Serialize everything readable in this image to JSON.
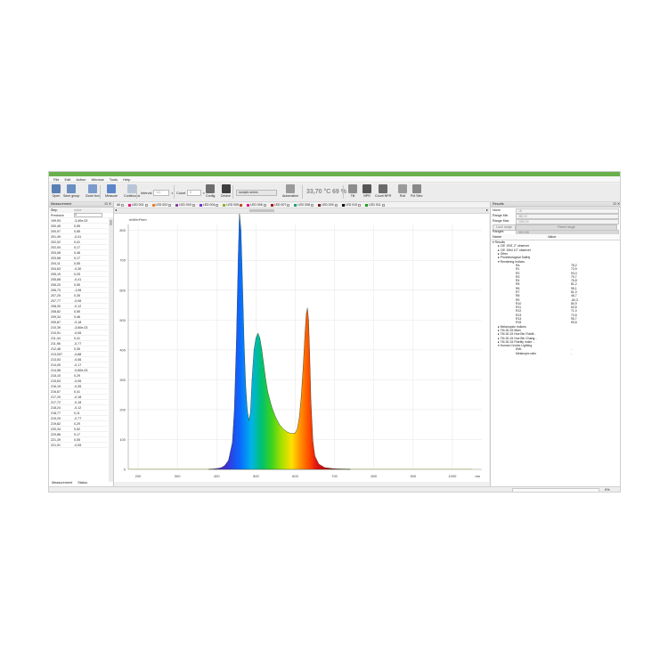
{
  "menu": [
    "File",
    "Edit",
    "Action",
    "Window",
    "Tools",
    "Help"
  ],
  "toolbar": {
    "buttons": [
      {
        "label": "Open",
        "icon": "folder-icon",
        "color": "#5a7fb5"
      },
      {
        "label": "Save group",
        "icon": "save-icon",
        "color": "#6a8fc0"
      },
      {
        "label": "Zoom box",
        "icon": "magnifier-icon",
        "color": "#7a9ccc"
      },
      {
        "label": "Measure",
        "icon": "spectrum-icon",
        "color": "#5b86c9"
      },
      {
        "label": "Continuous",
        "icon": "continuous-icon",
        "color": "#b8c6d8"
      },
      {
        "label": "Config",
        "icon": "tools-icon",
        "color": "#6d6d6d"
      },
      {
        "label": "Device",
        "icon": "device-icon",
        "color": "#3e3e3e"
      },
      {
        "label": "Automation",
        "icon": "gear-icon",
        "color": "#9a9a9a"
      },
      {
        "label": "Tilt",
        "icon": "tilt-icon",
        "color": "#8d8d8d"
      },
      {
        "label": "NPR",
        "icon": "npr-icon",
        "color": "#555555"
      },
      {
        "label": "Count NPR",
        "icon": "count-npr-icon",
        "color": "#6a6a6a"
      },
      {
        "label": "Roll",
        "icon": "roll-icon",
        "color": "#9a9a9a"
      },
      {
        "label": "Pol Stev",
        "icon": "pol-icon",
        "color": "#888888"
      }
    ],
    "interval_label": "Interval",
    "interval_value": "0,0",
    "count_label": "Count",
    "count_value": "0",
    "sample_value": "sample-series",
    "temperature": "33,70 °C",
    "percent": "69 %"
  },
  "left_panel": {
    "title": "Measurement",
    "step_label": "Step",
    "step_value": "value",
    "precision_label": "Precision",
    "precision_value": "1",
    "rows": [
      [
        "199,93",
        "-3,40e-03"
      ],
      [
        "200,45",
        "0,55"
      ],
      [
        "200,97",
        "0,55"
      ],
      [
        "201,49",
        "-0,41"
      ],
      [
        "202,02",
        "0,41"
      ],
      [
        "202,54",
        "0,17"
      ],
      [
        "203,06",
        "0,46"
      ],
      [
        "203,58",
        "0,17"
      ],
      [
        "204,11",
        "0,55"
      ],
      [
        "204,63",
        "-0,30"
      ],
      [
        "205,15",
        "0,25"
      ],
      [
        "205,68",
        "-0,41"
      ],
      [
        "206,20",
        "0,55"
      ],
      [
        "206,73",
        "-1,06"
      ],
      [
        "207,25",
        "0,35"
      ],
      [
        "207,77",
        "-0,06"
      ],
      [
        "208,30",
        "-0,12"
      ],
      [
        "208,82",
        "0,55"
      ],
      [
        "209,34",
        "0,46"
      ],
      [
        "209,87",
        "-0,18"
      ],
      [
        "210,39",
        "-3,60e-03"
      ],
      [
        "210,91",
        "-0,06"
      ],
      [
        "211,44",
        "0,41"
      ],
      [
        "211,96",
        "-0,77"
      ],
      [
        "212,48",
        "0,35"
      ],
      [
        "213,007",
        "-0,88"
      ],
      [
        "213,53",
        "-0,06"
      ],
      [
        "214,05",
        "-0,17"
      ],
      [
        "214,58",
        "-0,60e-03"
      ],
      [
        "215,10",
        "0,29"
      ],
      [
        "215,63",
        "-0,06"
      ],
      [
        "216,15",
        "-0,35"
      ],
      [
        "216,67",
        "0,41"
      ],
      [
        "217,20",
        "-0,18"
      ],
      [
        "217,72",
        "-0,18"
      ],
      [
        "218,24",
        "-0,12"
      ],
      [
        "218,77",
        "0,11"
      ],
      [
        "219,29",
        "-0,77"
      ],
      [
        "219,82",
        "0,29"
      ],
      [
        "220,34",
        "0,52"
      ],
      [
        "220,86",
        "0,17"
      ],
      [
        "221,39",
        "0,05"
      ],
      [
        "221,91",
        "-0,05"
      ]
    ],
    "tabs": [
      "Measurement",
      "Status"
    ]
  },
  "series_bar": {
    "all_label": "All",
    "items": [
      {
        "label": "LED 001",
        "color": "#e8177c"
      },
      {
        "label": "LED 002",
        "color": "#f07d20"
      },
      {
        "label": "LED 003",
        "color": "#8b3fa8"
      },
      {
        "label": "LED 004",
        "color": "#7a2fd0"
      },
      {
        "label": "LED 005",
        "color": "#8cb320",
        "checked": true
      },
      {
        "label": "LED 006",
        "color": "#e8177c"
      },
      {
        "label": "LED 007",
        "color": "#b01818"
      },
      {
        "label": "LED 008",
        "color": "#1aa37a"
      },
      {
        "label": "LED 009",
        "color": "#7a2020"
      },
      {
        "label": "LED 010",
        "color": "#101010"
      },
      {
        "label": "LED 011",
        "color": "#20a020"
      }
    ]
  },
  "chart_data": {
    "type": "area",
    "ylabel": "mW/m²/nm",
    "xlabel": "nm",
    "xlim": [
      175,
      1075
    ],
    "ylim": [
      0,
      820
    ],
    "xticks": [
      200,
      300,
      400,
      500,
      600,
      700,
      800,
      900,
      1000
    ],
    "yticks": [
      0,
      100,
      200,
      300,
      400,
      500,
      600,
      700,
      800
    ],
    "x": [
      380,
      395,
      410,
      420,
      430,
      440,
      445,
      450,
      455,
      458,
      462,
      466,
      470,
      474,
      478,
      482,
      486,
      490,
      495,
      500,
      505,
      510,
      515,
      520,
      525,
      530,
      540,
      550,
      560,
      570,
      580,
      590,
      600,
      605,
      610,
      615,
      620,
      625,
      628,
      631,
      634,
      637,
      640,
      645,
      650,
      660,
      675,
      700,
      740
    ],
    "y": [
      0,
      2,
      5,
      12,
      30,
      90,
      200,
      420,
      720,
      860,
      800,
      620,
      420,
      280,
      200,
      165,
      190,
      300,
      400,
      440,
      456,
      440,
      400,
      350,
      300,
      260,
      210,
      175,
      150,
      135,
      125,
      120,
      122,
      135,
      170,
      240,
      340,
      460,
      520,
      540,
      500,
      380,
      230,
      95,
      45,
      18,
      6,
      2,
      0
    ]
  },
  "results": {
    "title": "Results",
    "norm_label": "Norm",
    "norm_value": "1B",
    "range_min_label": "Range Min",
    "range_min_value": "380,00",
    "range_max_label": "Range Max",
    "range_max_value": "1000,00",
    "lock_range": "Lock range",
    "reset_range": "Reset range",
    "ranges_label": "Ranges",
    "ranges_value": "VIS 10D",
    "col_name": "Name",
    "col_value": "Value",
    "tree": [
      {
        "d": 0,
        "t": "Results",
        "v": ""
      },
      {
        "d": 1,
        "t": "CIE 1931 2° observer",
        "v": ""
      },
      {
        "d": 1,
        "t": "CIE 1964 10° observer",
        "v": ""
      },
      {
        "d": 1,
        "t": "Other",
        "v": ""
      },
      {
        "d": 1,
        "t": "Photobiological Safety",
        "v": ""
      },
      {
        "d": 1,
        "t": "Rendering Indices",
        "v": ""
      },
      {
        "d": 2,
        "t": "Ra",
        "v": "78,2"
      },
      {
        "d": 2,
        "t": "R1",
        "v": "73,9"
      },
      {
        "d": 2,
        "t": "R2",
        "v": "93,0"
      },
      {
        "d": 2,
        "t": "R3",
        "v": "79,7"
      },
      {
        "d": 2,
        "t": "R4",
        "v": "76,8"
      },
      {
        "d": 2,
        "t": "R5",
        "v": "81,2"
      },
      {
        "d": 2,
        "t": "R6",
        "v": "95,1"
      },
      {
        "d": 2,
        "t": "R7",
        "v": "81,0"
      },
      {
        "d": 2,
        "t": "R8",
        "v": "46,7"
      },
      {
        "d": 2,
        "t": "R9",
        "v": "-60,3"
      },
      {
        "d": 2,
        "t": "R10",
        "v": "80,9"
      },
      {
        "d": 2,
        "t": "R11",
        "v": "63,6"
      },
      {
        "d": 2,
        "t": "R12",
        "v": "71,0"
      },
      {
        "d": 2,
        "t": "R13",
        "v": "73,5"
      },
      {
        "d": 2,
        "t": "R14",
        "v": "95,7"
      },
      {
        "d": 2,
        "t": "R15",
        "v": "59,6"
      },
      {
        "d": 1,
        "t": "Melanopsin Indices",
        "v": ""
      },
      {
        "d": 1,
        "t": "TM-30-15 Main",
        "v": ""
      },
      {
        "d": 1,
        "t": "TM-30-15 Hue Bin Fidelit...",
        "v": ""
      },
      {
        "d": 1,
        "t": "TM-30-15 Hue Bin Chang...",
        "v": ""
      },
      {
        "d": 1,
        "t": "TM-30-15 Fidelity Index ...",
        "v": ""
      },
      {
        "d": 1,
        "t": "Human Centric Lighting",
        "v": ""
      },
      {
        "d": 2,
        "t": "EML",
        "v": "-"
      },
      {
        "d": 2,
        "t": "Melanopic ratio",
        "v": "-"
      }
    ]
  },
  "status": {
    "progress": "0%"
  }
}
